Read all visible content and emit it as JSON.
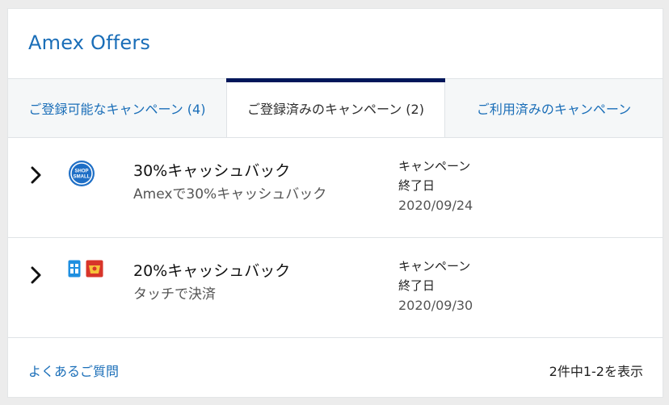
{
  "header": {
    "title": "Amex Offers"
  },
  "tabs": [
    {
      "label": "ご登録可能なキャンペーン (4)",
      "active": false
    },
    {
      "label": "ご登録済みのキャンペーン (2)",
      "active": true
    },
    {
      "label": "ご利用済みのキャンペーン",
      "active": false
    }
  ],
  "offers": [
    {
      "title": "30%キャッシュバック",
      "subtitle": "Amexで30%キャッシュバック",
      "campaign_label_line1": "キャンペーン",
      "campaign_label_line2": "終了日",
      "end_date": "2020/09/24",
      "logos": [
        "shop-small-logo"
      ],
      "logo_text": [
        "SHOP",
        "SMALL"
      ]
    },
    {
      "title": "20%キャッシュバック",
      "subtitle": "タッチで決済",
      "campaign_label_line1": "キャンペーン",
      "campaign_label_line2": "終了日",
      "end_date": "2020/09/30",
      "logos": [
        "contactless-icon",
        "merchant-logo"
      ]
    }
  ],
  "footer": {
    "faq_link": "よくあるご質問",
    "result_count": "2件中1-2を表示"
  },
  "colors": {
    "accent_blue": "#1a6eb8",
    "active_tab_bar": "#00175a",
    "background": "#ececec"
  }
}
